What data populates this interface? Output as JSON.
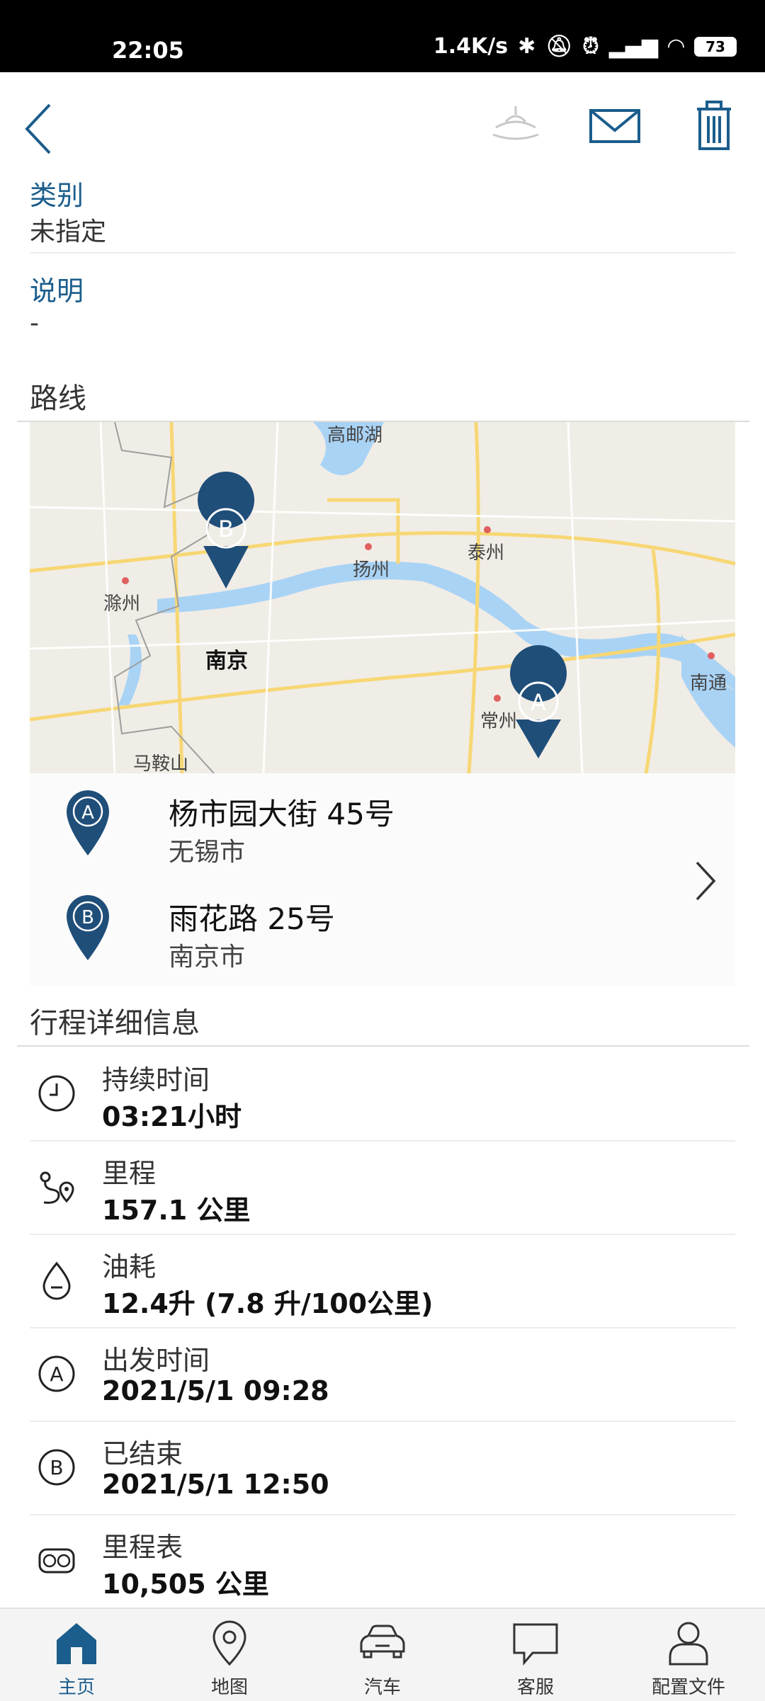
{
  "status_bar": {
    "time": "22:05",
    "network_speed": "1.4K/s",
    "battery": "73"
  },
  "toolbar": {
    "back_icon": "chevron-left-icon",
    "actions": [
      "spray-icon",
      "mail-icon",
      "trash-icon"
    ]
  },
  "fields": [
    {
      "label": "类别",
      "value": "未指定"
    },
    {
      "label": "说明",
      "value": "-"
    }
  ],
  "route": {
    "title": "路线",
    "map_cities": [
      "高邮湖",
      "扬州",
      "泰州",
      "滁州",
      "南京",
      "南通",
      "常州",
      "马鞍山"
    ],
    "start": {
      "badge": "A",
      "street": "杨市园大街 45号",
      "city": "无锡市"
    },
    "end": {
      "badge": "B",
      "street": "雨花路 25号",
      "city": "南京市"
    }
  },
  "trip_details": {
    "title": "行程详细信息",
    "items": [
      {
        "icon": "clock-icon",
        "label": "持续时间",
        "value": "03:21小时"
      },
      {
        "icon": "route-icon",
        "label": "里程",
        "value": "157.1 公里"
      },
      {
        "icon": "fuel-drop-icon",
        "label": "油耗",
        "value": "12.4升 (7.8 升/100公里)"
      },
      {
        "icon": "point-a-icon",
        "label": "出发时间",
        "value": "2021/5/1 09:28"
      },
      {
        "icon": "point-b-icon",
        "label": "已结束",
        "value": "2021/5/1 12:50"
      },
      {
        "icon": "odometer-icon",
        "label": "里程表",
        "value": "10,505 公里"
      }
    ]
  },
  "tabs": [
    {
      "label": "主页",
      "icon": "home-icon",
      "active": true
    },
    {
      "label": "地图",
      "icon": "map-pin-icon",
      "active": false
    },
    {
      "label": "汽车",
      "icon": "car-icon",
      "active": false
    },
    {
      "label": "客服",
      "icon": "chat-icon",
      "active": false
    },
    {
      "label": "配置文件",
      "icon": "profile-icon",
      "active": false
    }
  ],
  "colors": {
    "accent": "#1b5d8c",
    "pin": "#1f4e79",
    "map_land": "#f0ede6",
    "map_water": "#a9d3f5",
    "map_road": "#f7d774"
  }
}
